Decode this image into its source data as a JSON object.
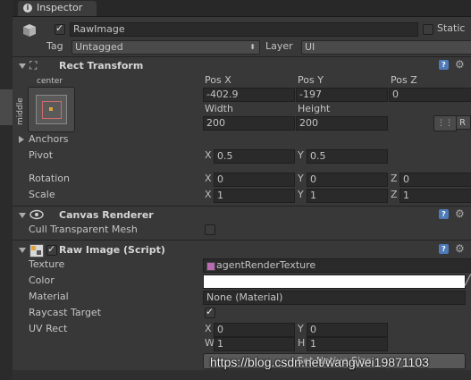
{
  "tab": {
    "title": "Inspector"
  },
  "header": {
    "object_name": "RawImage",
    "static_label": "Static",
    "tag_label": "Tag",
    "tag_value": "Untagged",
    "layer_label": "Layer",
    "layer_value": "UI"
  },
  "rect_transform": {
    "title": "Rect Transform",
    "anchor_preset_top": "center",
    "anchor_preset_side": "middle",
    "pos_x_label": "Pos X",
    "pos_y_label": "Pos Y",
    "pos_z_label": "Pos Z",
    "pos_x": "-402.9",
    "pos_y": "-197",
    "pos_z": "0",
    "width_label": "Width",
    "height_label": "Height",
    "width": "200",
    "height": "200",
    "r_button": "R",
    "anchors_label": "Anchors",
    "pivot_label": "Pivot",
    "pivot_x": "0.5",
    "pivot_y": "0.5",
    "rotation_label": "Rotation",
    "rot_x": "0",
    "rot_y": "0",
    "rot_z": "0",
    "scale_label": "Scale",
    "scale_x": "1",
    "scale_y": "1",
    "scale_z": "1",
    "axis_x": "X",
    "axis_y": "Y",
    "axis_z": "Z"
  },
  "canvas_renderer": {
    "title": "Canvas Renderer",
    "cull_label": "Cull Transparent Mesh"
  },
  "raw_image": {
    "title": "Raw Image (Script)",
    "texture_label": "Texture",
    "texture_value": "agentRenderTexture",
    "color_label": "Color",
    "color_value": "#ffffff",
    "material_label": "Material",
    "material_value": "None (Material)",
    "raycast_label": "Raycast Target",
    "uv_rect_label": "UV Rect",
    "uv_x": "0",
    "uv_y": "0",
    "uv_w": "1",
    "uv_h": "1",
    "axis_x": "X",
    "axis_y": "Y",
    "axis_w": "W",
    "axis_h": "H",
    "native_size_button": "Set Native Size"
  },
  "watermark": "https://blog.csdn.net/wangwei19871103"
}
